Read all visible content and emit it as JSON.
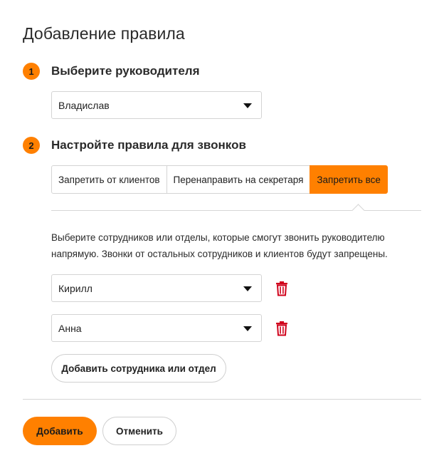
{
  "title": "Добавление правила",
  "step1": {
    "number": "1",
    "title": "Выберите руководителя",
    "manager_select": {
      "value": "Владислав"
    }
  },
  "step2": {
    "number": "2",
    "title": "Настройте правила для звонков",
    "tabs": [
      {
        "label": "Запретить от клиентов",
        "active": false
      },
      {
        "label": "Перенаправить на секретаря",
        "active": false
      },
      {
        "label": "Запретить все",
        "active": true
      }
    ],
    "description": "Выберите сотрудников или отделы, которые смогут звонить руководителю напрямую. Звонки от остальных сотрудников и клиентов будут запрещены.",
    "employees": [
      {
        "value": "Кирилл",
        "delete_icon": "trash-icon"
      },
      {
        "value": "Анна",
        "delete_icon": "trash-icon"
      }
    ],
    "add_employee_label": "Добавить сотрудника или отдел"
  },
  "footer": {
    "submit_label": "Добавить",
    "cancel_label": "Отменить"
  },
  "colors": {
    "accent": "#ff8000",
    "delete": "#d0021b",
    "border": "#d4d4d4"
  }
}
